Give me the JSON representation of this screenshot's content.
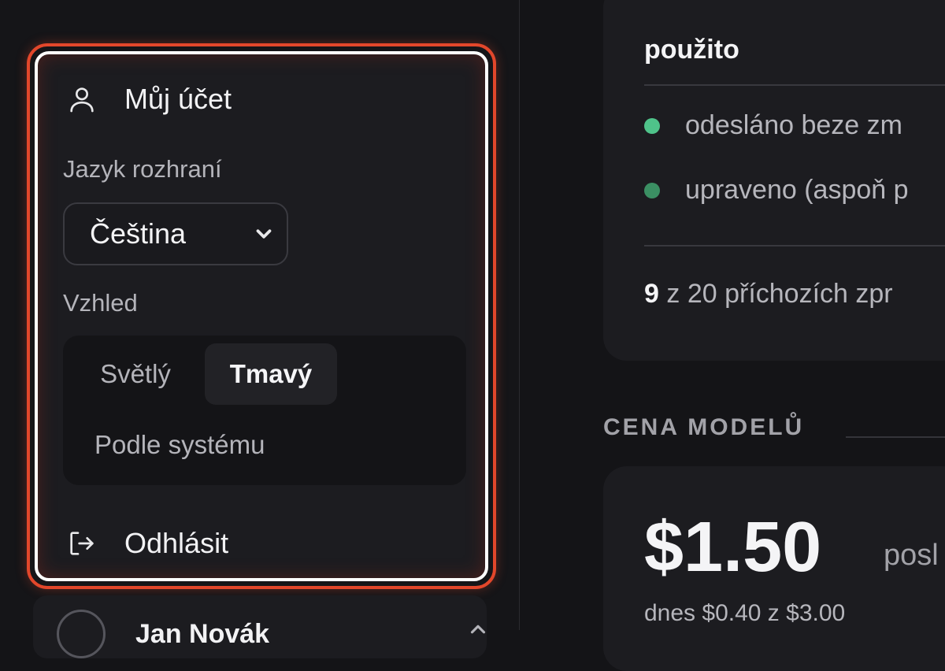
{
  "account_menu": {
    "account_label": "Můj účet",
    "language_label": "Jazyk rozhraní",
    "language_selected": "Čeština",
    "appearance_label": "Vzhled",
    "theme_options": {
      "light": "Světlý",
      "dark": "Tmavý",
      "system": "Podle systému"
    },
    "theme_selected": "dark",
    "logout_label": "Odhlásit",
    "highlight_color": "#e2472b"
  },
  "user_bar": {
    "name": "Jan Novák"
  },
  "usage_card": {
    "title": "použito",
    "legend": [
      {
        "label": "odesláno beze zm",
        "color": "#4fc38a"
      },
      {
        "label": "upraveno (aspoň p",
        "color": "#3b8f63"
      }
    ],
    "count_value": "9",
    "count_text": "z 20 příchozích zpr"
  },
  "pricing": {
    "section_title": "CENA MODELŮ",
    "amount": "$1.50",
    "amount_suffix": "posl",
    "daily_text": "dnes $0.40 z $3.00"
  }
}
